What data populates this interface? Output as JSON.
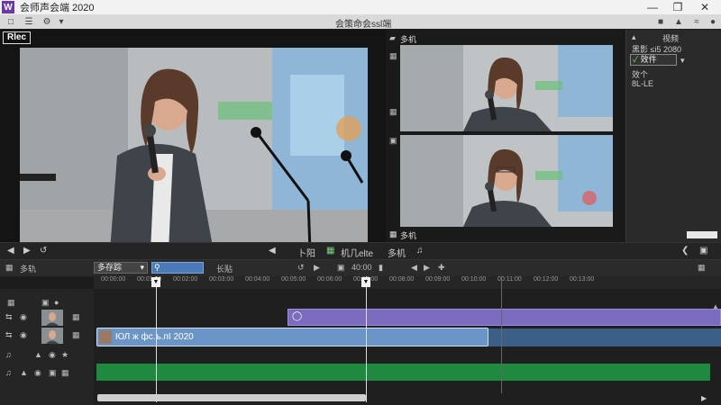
{
  "window": {
    "app_icon": "W",
    "title": "会师声会端 2020",
    "controls": [
      "minimize-icon",
      "restore-icon",
      "close-icon"
    ]
  },
  "toolbar": {
    "center_text": "会策命会ssl端",
    "icons": [
      "home-icon",
      "list-icon",
      "settings-icon",
      "bell-icon",
      "upload-icon",
      "share-icon",
      "user-icon"
    ]
  },
  "preview": {
    "rec_label": "Rlec",
    "cam_top_label": "多机",
    "cam_bottom_label": "多机"
  },
  "right_panel": {
    "title": "视频",
    "items": [
      "黑影 ≤i5 2080",
      "效件",
      "效个",
      "8L-LE"
    ],
    "selected_index": 1
  },
  "playback": {
    "left_icons": [
      "skip-back-icon",
      "play-icon"
    ],
    "center_label_1": "卜阳",
    "center_label_2": "机几elte",
    "center_label_3": "多机",
    "right_icons": [
      "close-panel-icon",
      "fullscreen-icon"
    ]
  },
  "timeline_header": {
    "track_label": "多轨",
    "dropdown_value": "多存踪",
    "search_placeholder": "",
    "left_label": "长贴",
    "timecode": "40:00",
    "right_label": "多机"
  },
  "ruler": {
    "ticks": [
      "00:00:00",
      "00:01:00",
      "00:02:00",
      "00:03:00",
      "00:04:00",
      "00:05:00",
      "00:06:00",
      "00:07:00",
      "00:08:00",
      "00:09:00",
      "00:10:00",
      "00:11:00",
      "00:12:00",
      "00:13:00"
    ]
  },
  "tracks": {
    "clip_blue_label": "ЮЛ ж фс.ъ.пI 2020"
  },
  "colors": {
    "accent_purple": "#7b6cc0",
    "accent_blue": "#6b95c6",
    "accent_green": "#1f8a3f",
    "brand": "#6b3aa8"
  }
}
